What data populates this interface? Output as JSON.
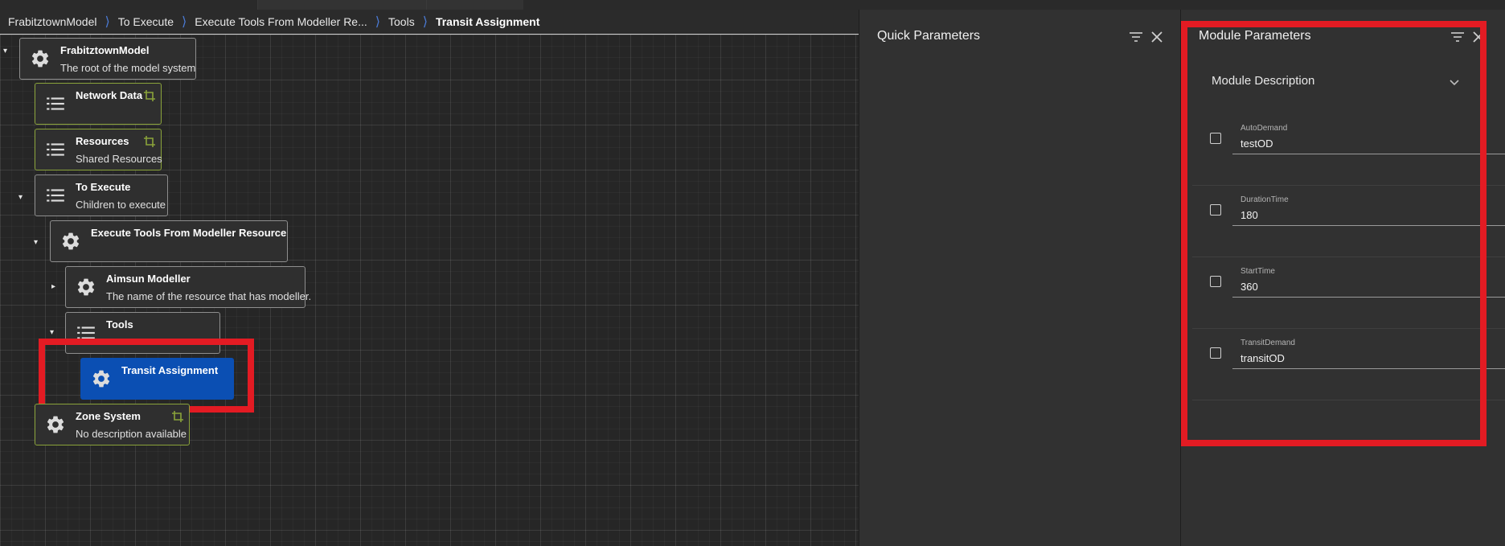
{
  "breadcrumb": [
    "FrabitztownModel",
    "To Execute",
    "Execute Tools From Modeller Re...",
    "Tools",
    "Transit Assignment"
  ],
  "tree": {
    "root": {
      "name": "FrabitztownModel",
      "desc": "The root of the model system",
      "icon": "gear-icon"
    },
    "network_data": {
      "name": "Network Data",
      "desc": "",
      "icon": "list-icon"
    },
    "resources": {
      "name": "Resources",
      "desc": "Shared Resources",
      "icon": "list-icon"
    },
    "to_execute": {
      "name": "To Execute",
      "desc": "Children to execute",
      "icon": "list-icon"
    },
    "exec_tools": {
      "name": "Execute Tools From Modeller Resource",
      "desc": "",
      "icon": "gear-icon"
    },
    "aimsun": {
      "name": "Aimsun Modeller",
      "desc": "The name of the resource that has modeller.",
      "icon": "gear-icon"
    },
    "tools": {
      "name": "Tools",
      "desc": "",
      "icon": "list-icon"
    },
    "transit": {
      "name": "Transit Assignment",
      "desc": "",
      "icon": "gear-icon"
    },
    "zone_system": {
      "name": "Zone System",
      "desc": "No description available",
      "icon": "gear-icon"
    }
  },
  "quick_parameters": {
    "title": "Quick Parameters"
  },
  "module_parameters": {
    "title": "Module Parameters",
    "description_header": "Module Description",
    "params": [
      {
        "label": "AutoDemand",
        "value": "testOD"
      },
      {
        "label": "DurationTime",
        "value": "180"
      },
      {
        "label": "StartTime",
        "value": "360"
      },
      {
        "label": "TransitDemand",
        "value": "transitOD"
      }
    ]
  },
  "colors": {
    "accent": "#0b4fb3",
    "highlight": "#e31b23",
    "link": "#8aa33a"
  }
}
